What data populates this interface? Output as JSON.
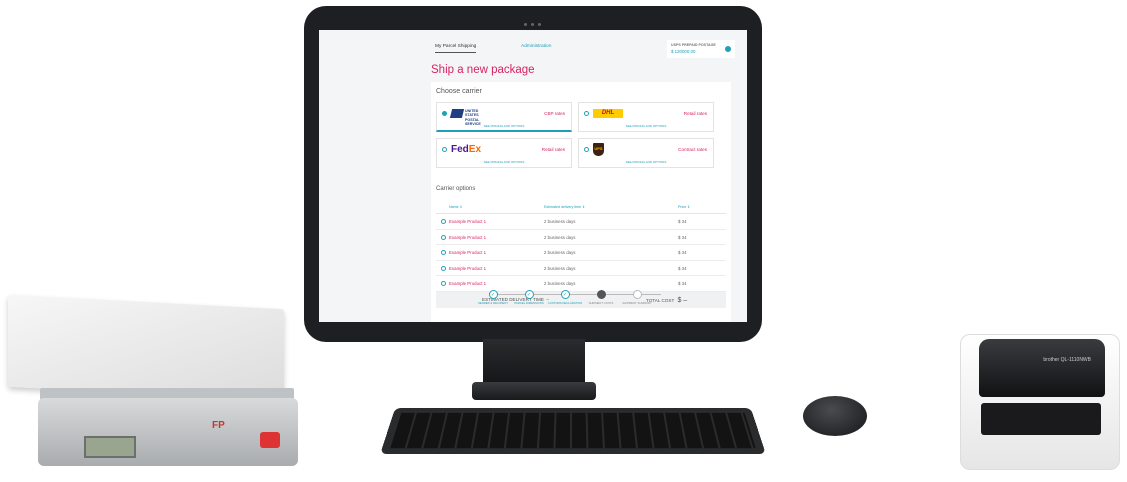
{
  "header": {
    "tabs": [
      {
        "label": "My Parcel Shipping",
        "active": true
      },
      {
        "label": "Administration",
        "active": false
      }
    ],
    "balance_label": "USPS PREPAID POSTAGE",
    "balance_value": "$ 120000.00"
  },
  "page_title": "Ship a new package",
  "choose_carrier": {
    "heading": "Choose carrier",
    "carriers": [
      {
        "logo": "usps-logo",
        "logo_text": "UNITED STATES POSTAL SERVICE",
        "rate": "CBP rates",
        "sub": "SEE PRICING AND OPTIONS",
        "selected": true
      },
      {
        "logo": "dhl-logo",
        "logo_text": "DHL",
        "rate": "Retail rates",
        "sub": "SEE PRICING AND OPTIONS",
        "selected": false
      },
      {
        "logo": "fedex-logo",
        "logo_text": "FedEx",
        "rate": "Retail rates",
        "sub": "SEE PRICING AND OPTIONS",
        "selected": false
      },
      {
        "logo": "ups-logo",
        "logo_text": "UPS",
        "rate": "Contract rates",
        "sub": "SEE PRICING AND OPTIONS",
        "selected": false
      }
    ]
  },
  "carrier_options": {
    "heading": "Carrier options",
    "columns": [
      "Name ⇕",
      "Estimated delivery time ⇕",
      "Price ⇕"
    ],
    "rows": [
      {
        "name": "Example Product 1",
        "time": "2 business days",
        "price": "$ 34"
      },
      {
        "name": "Example Product 1",
        "time": "2 business days",
        "price": "$ 34"
      },
      {
        "name": "Example Product 1",
        "time": "2 business days",
        "price": "$ 34"
      },
      {
        "name": "Example Product 1",
        "time": "2 business days",
        "price": "$ 34"
      },
      {
        "name": "Example Product 1",
        "time": "2 business days",
        "price": "$ 34"
      }
    ],
    "estimated_label": "ESTIMATED DELIVERY TIME",
    "estimated_value": "–",
    "total_label": "TOTAL COST",
    "total_value": "$ –"
  },
  "steps": [
    {
      "label": "SENDER & RECIPIENT",
      "state": "done"
    },
    {
      "label": "PARCEL DIMENSIONS",
      "state": "done"
    },
    {
      "label": "CUSTOMS DECLARATION",
      "state": "done"
    },
    {
      "label": "SHIPMENT COSTS",
      "state": "current"
    },
    {
      "label": "SHIPMENT SUMMARY",
      "state": "todo"
    }
  ],
  "devices": {
    "scale_brand": "FP",
    "printer_model": "brother QL-1110NWB"
  }
}
